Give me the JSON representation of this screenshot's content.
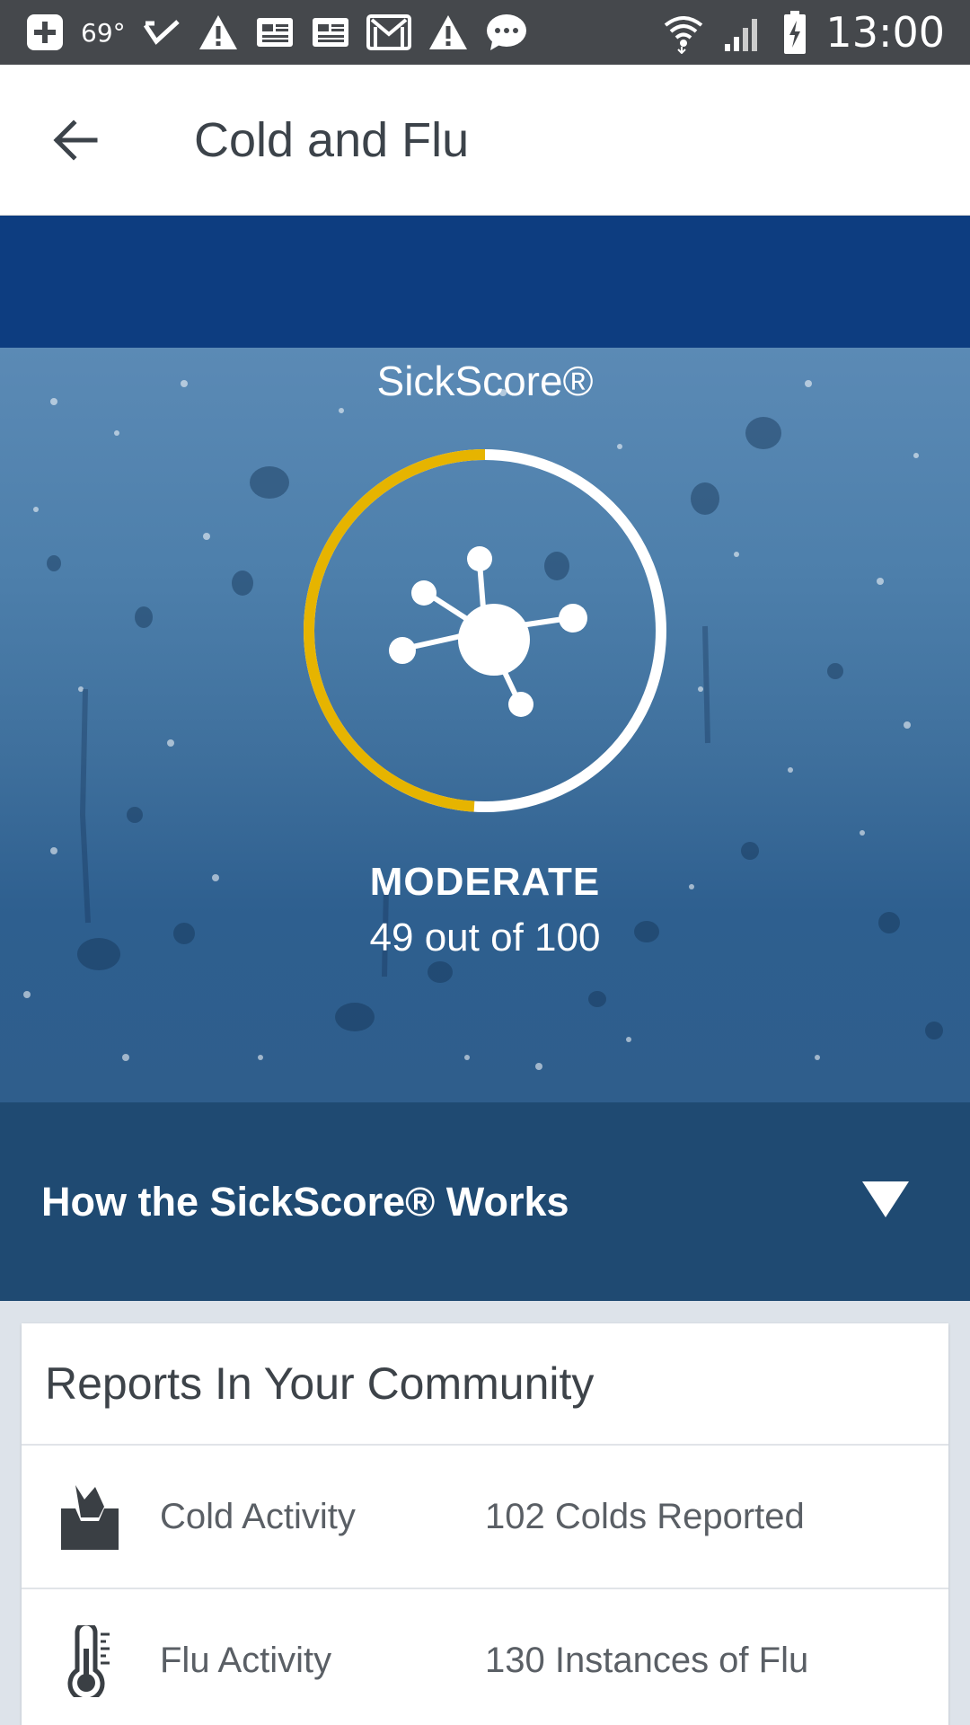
{
  "status_bar": {
    "temperature": "69°",
    "time": "13:00",
    "icons": [
      "add-box-icon",
      "temperature-text",
      "check-icon",
      "warning-icon",
      "news-icon",
      "news-icon",
      "gmail-icon",
      "warning-icon",
      "chat-icon",
      "wifi-icon",
      "signal-icon",
      "battery-charging-icon"
    ]
  },
  "app_bar": {
    "back_icon": "arrow-back-icon",
    "title": "Cold and Flu"
  },
  "hero": {
    "title": "SickScore®",
    "level": "MODERATE",
    "score_text": "49 out of 100",
    "score_value": 49,
    "score_max": 100,
    "gauge_fill_color": "#e6b400",
    "gauge_track_color": "#ffffff",
    "center_icon": "virus-molecule-icon"
  },
  "how_it_works": {
    "label": "How the SickScore® Works",
    "toggle_icon": "triangle-down-icon"
  },
  "community": {
    "title": "Reports In Your Community",
    "rows": [
      {
        "icon": "tissue-box-icon",
        "label": "Cold Activity",
        "value": "102 Colds Reported"
      },
      {
        "icon": "thermometer-icon",
        "label": "Flu Activity",
        "value": "130 Instances of Flu"
      }
    ]
  },
  "colors": {
    "status_bar": "#45484c",
    "app_bar": "#ffffff",
    "blue_band": "#0d3d80",
    "how_bar": "#1f4a72",
    "page_bg": "#dde3ea"
  }
}
